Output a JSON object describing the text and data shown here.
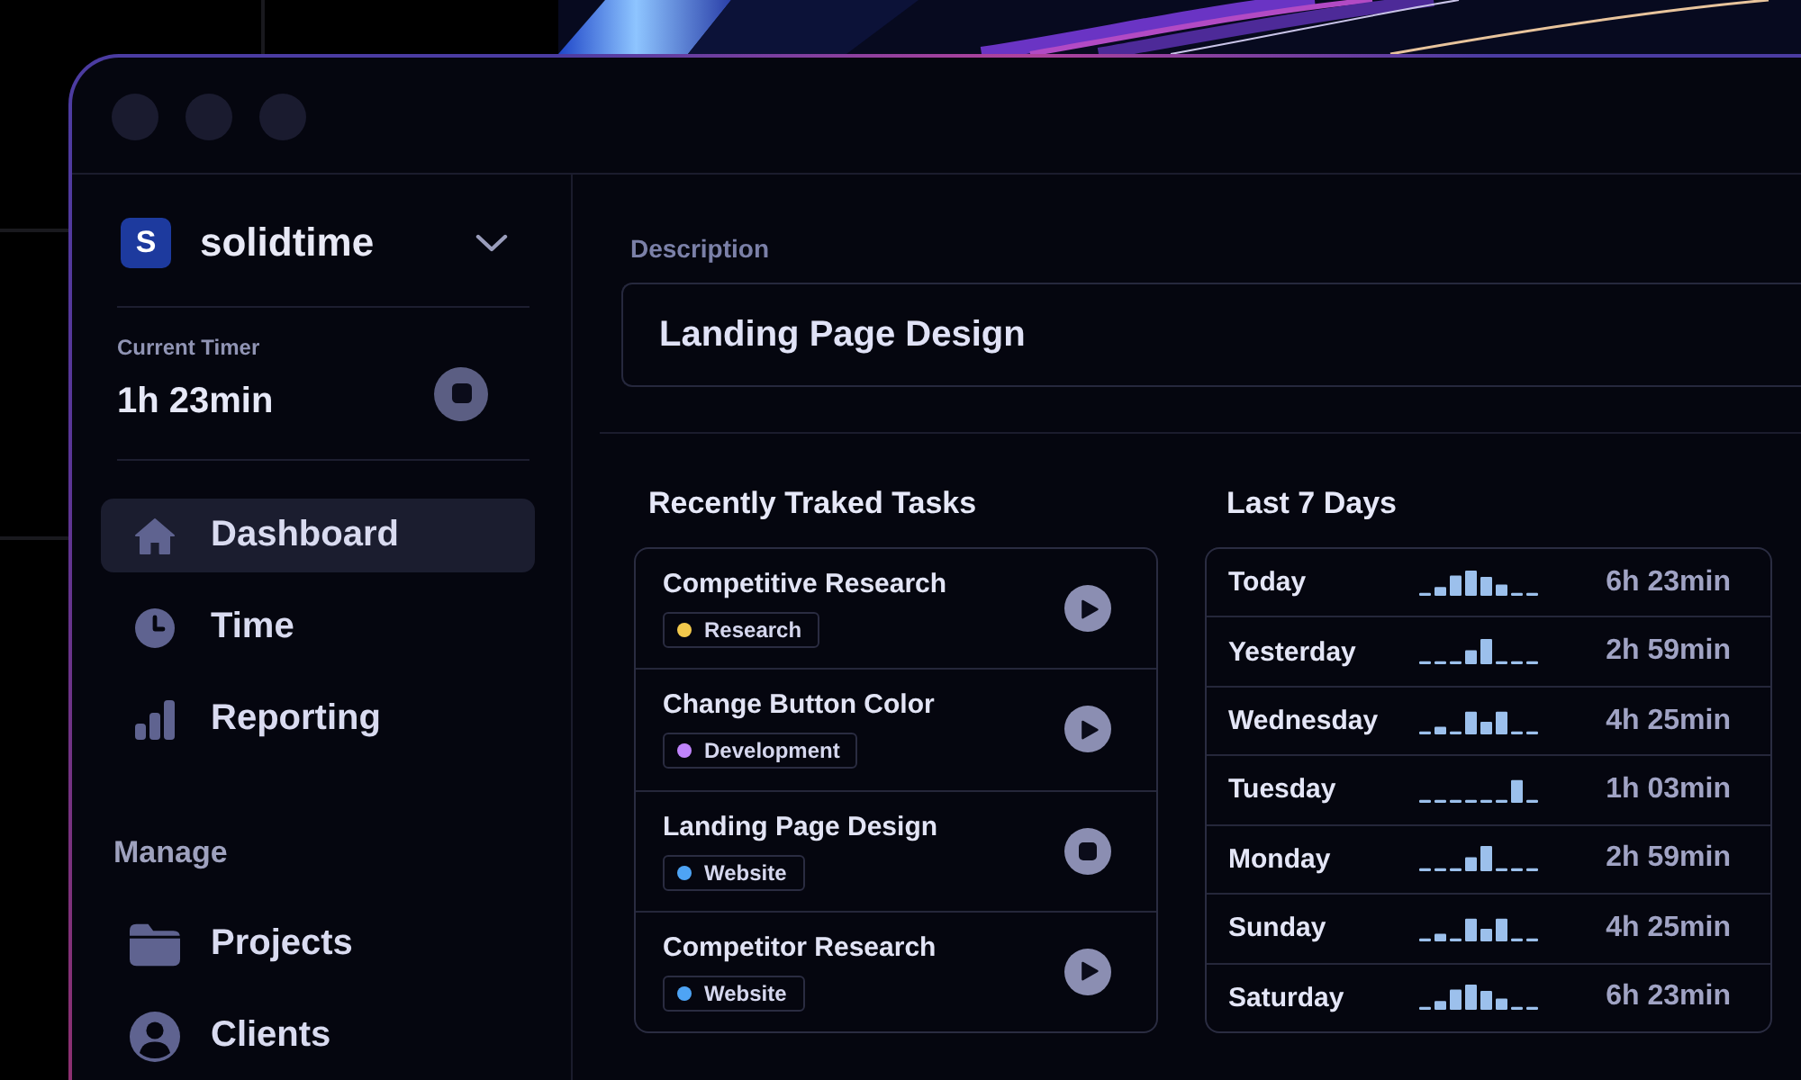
{
  "sidebar": {
    "organization": {
      "initial": "S",
      "name": "solidtime"
    },
    "current_timer": {
      "label": "Current Timer",
      "value": "1h 23min",
      "running": true
    },
    "nav_items": [
      {
        "label": "Dashboard",
        "selected": true
      },
      {
        "label": "Time",
        "selected": false
      },
      {
        "label": "Reporting",
        "selected": false
      }
    ],
    "manage": {
      "heading": "Manage",
      "items": [
        {
          "label": "Projects",
          "selected": false
        },
        {
          "label": "Clients",
          "selected": false
        }
      ]
    }
  },
  "description": {
    "label": "Description",
    "value": "Landing Page Design"
  },
  "recent_tasks": {
    "title": "Recently Traked Tasks",
    "tasks": [
      {
        "name": "Competitive Research",
        "project": {
          "name": "Research",
          "color": "#f2c94c"
        },
        "running": false
      },
      {
        "name": "Change Button Color",
        "project": {
          "name": "Development",
          "color": "#c084fc"
        },
        "running": false
      },
      {
        "name": "Landing Page Design",
        "project": {
          "name": "Website",
          "color": "#4ea4f5"
        },
        "running": true
      },
      {
        "name": "Competitor Research",
        "project": {
          "name": "Website",
          "color": "#4ea4f5"
        },
        "running": false
      }
    ]
  },
  "last_7_days": {
    "title": "Last 7 Days",
    "days": [
      {
        "day": "Today",
        "total": "6h 23min"
      },
      {
        "day": "Yesterday",
        "total": "2h 59min"
      },
      {
        "day": "Wednesday",
        "total": "4h 25min"
      },
      {
        "day": "Tuesday",
        "total": "1h 03min"
      },
      {
        "day": "Monday",
        "total": "2h 59min"
      },
      {
        "day": "Sunday",
        "total": "4h 25min"
      },
      {
        "day": "Saturday",
        "total": "6h 23min"
      }
    ]
  }
}
